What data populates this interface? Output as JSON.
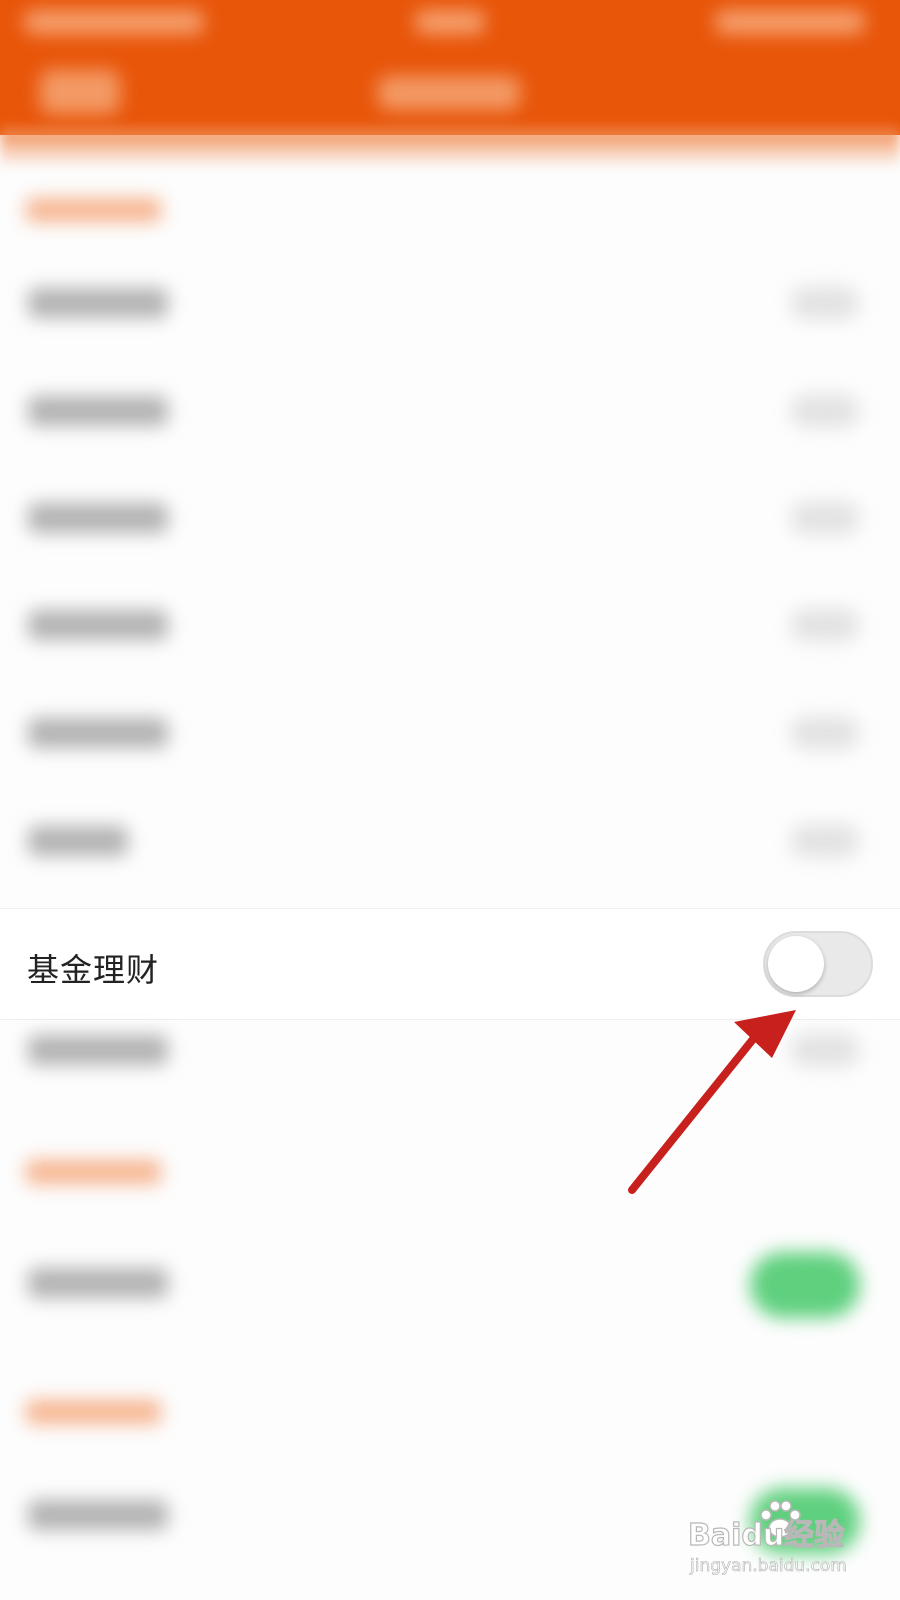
{
  "colors": {
    "header": "#e8560a",
    "accent_label": "#f6b48f",
    "toggle_on": "#5fd07e",
    "toggle_off": "#e9e9ea",
    "arrow": "#c8201c"
  },
  "focused_setting": {
    "label": "基金理财",
    "toggle_state": "off"
  },
  "annotation": {
    "icon": "red-arrow-icon"
  },
  "watermark": {
    "brand": "Baidu经验",
    "url": "jingyan.baidu.com"
  }
}
